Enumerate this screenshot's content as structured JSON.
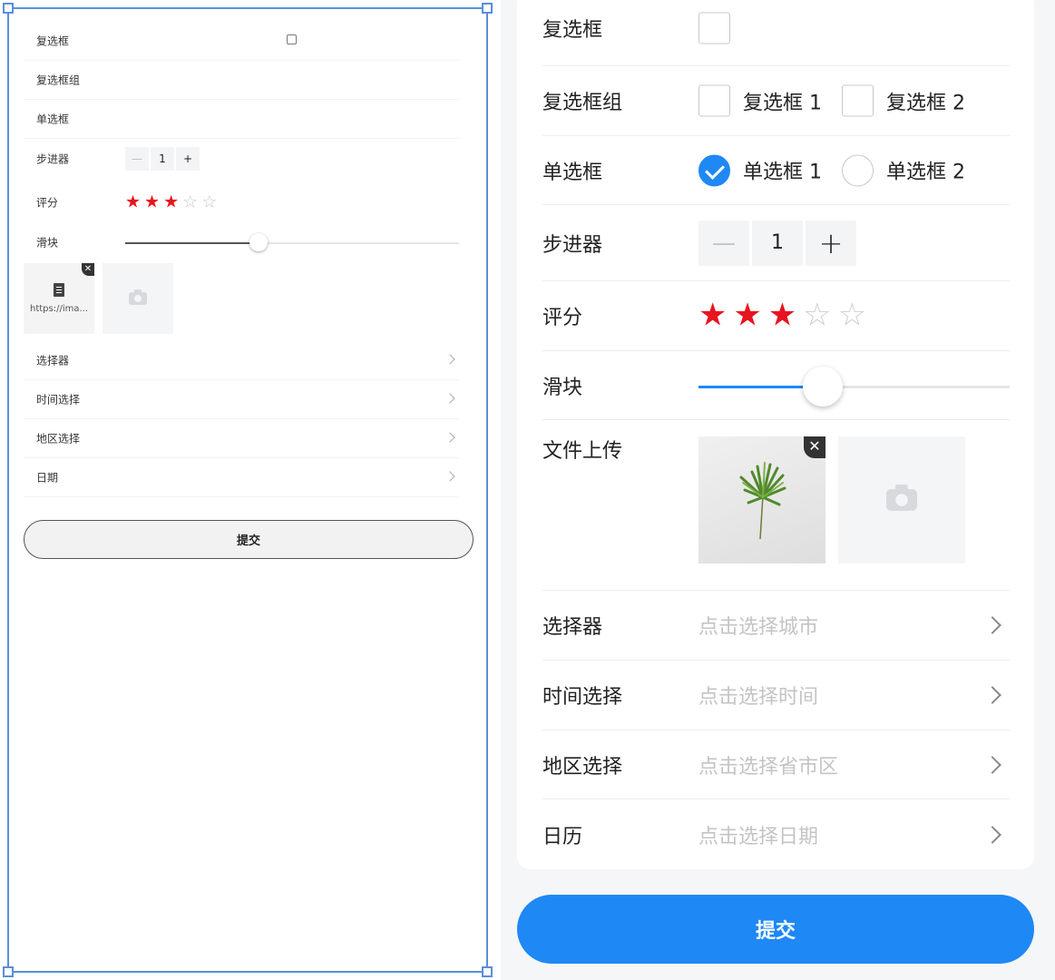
{
  "preview": {
    "fields": {
      "checkbox_label": "复选框",
      "checkbox_group_label": "复选框组",
      "radio_label": "单选框",
      "stepper_label": "步进器",
      "stepper_value": "1",
      "rate_label": "评分",
      "slider_label": "滑块",
      "upload_file_name": "https://ima...",
      "picker_label": "选择器",
      "time_label": "时间选择",
      "area_label": "地区选择",
      "date_label": "日期"
    },
    "submit_label": "提交"
  },
  "form": {
    "checkbox": {
      "label": "复选框",
      "checked": false
    },
    "checkbox_group": {
      "label": "复选框组",
      "options": [
        "复选框 1",
        "复选框 2"
      ]
    },
    "radio": {
      "label": "单选框",
      "options": [
        "单选框 1",
        "单选框 2"
      ],
      "selected": "单选框 1"
    },
    "stepper": {
      "label": "步进器",
      "value": "1"
    },
    "rate": {
      "label": "评分",
      "value": 3,
      "max": 5
    },
    "slider": {
      "label": "滑块",
      "value_percent": 40
    },
    "uploader": {
      "label": "文件上传",
      "file_count": 1
    },
    "picker": {
      "label": "选择器",
      "placeholder": "点击选择城市"
    },
    "time_picker": {
      "label": "时间选择",
      "placeholder": "点击选择时间"
    },
    "area_picker": {
      "label": "地区选择",
      "placeholder": "点击选择省市区"
    },
    "calendar": {
      "label": "日历",
      "placeholder": "点击选择日期"
    },
    "submit_label": "提交"
  },
  "colors": {
    "accent": "#1e88f5",
    "star_active": "#e8141f",
    "selection_frame": "#5b8fd9"
  },
  "icons": [
    "chevron-right-icon",
    "camera-icon",
    "close-icon",
    "file-icon",
    "check-icon",
    "star-icon"
  ]
}
